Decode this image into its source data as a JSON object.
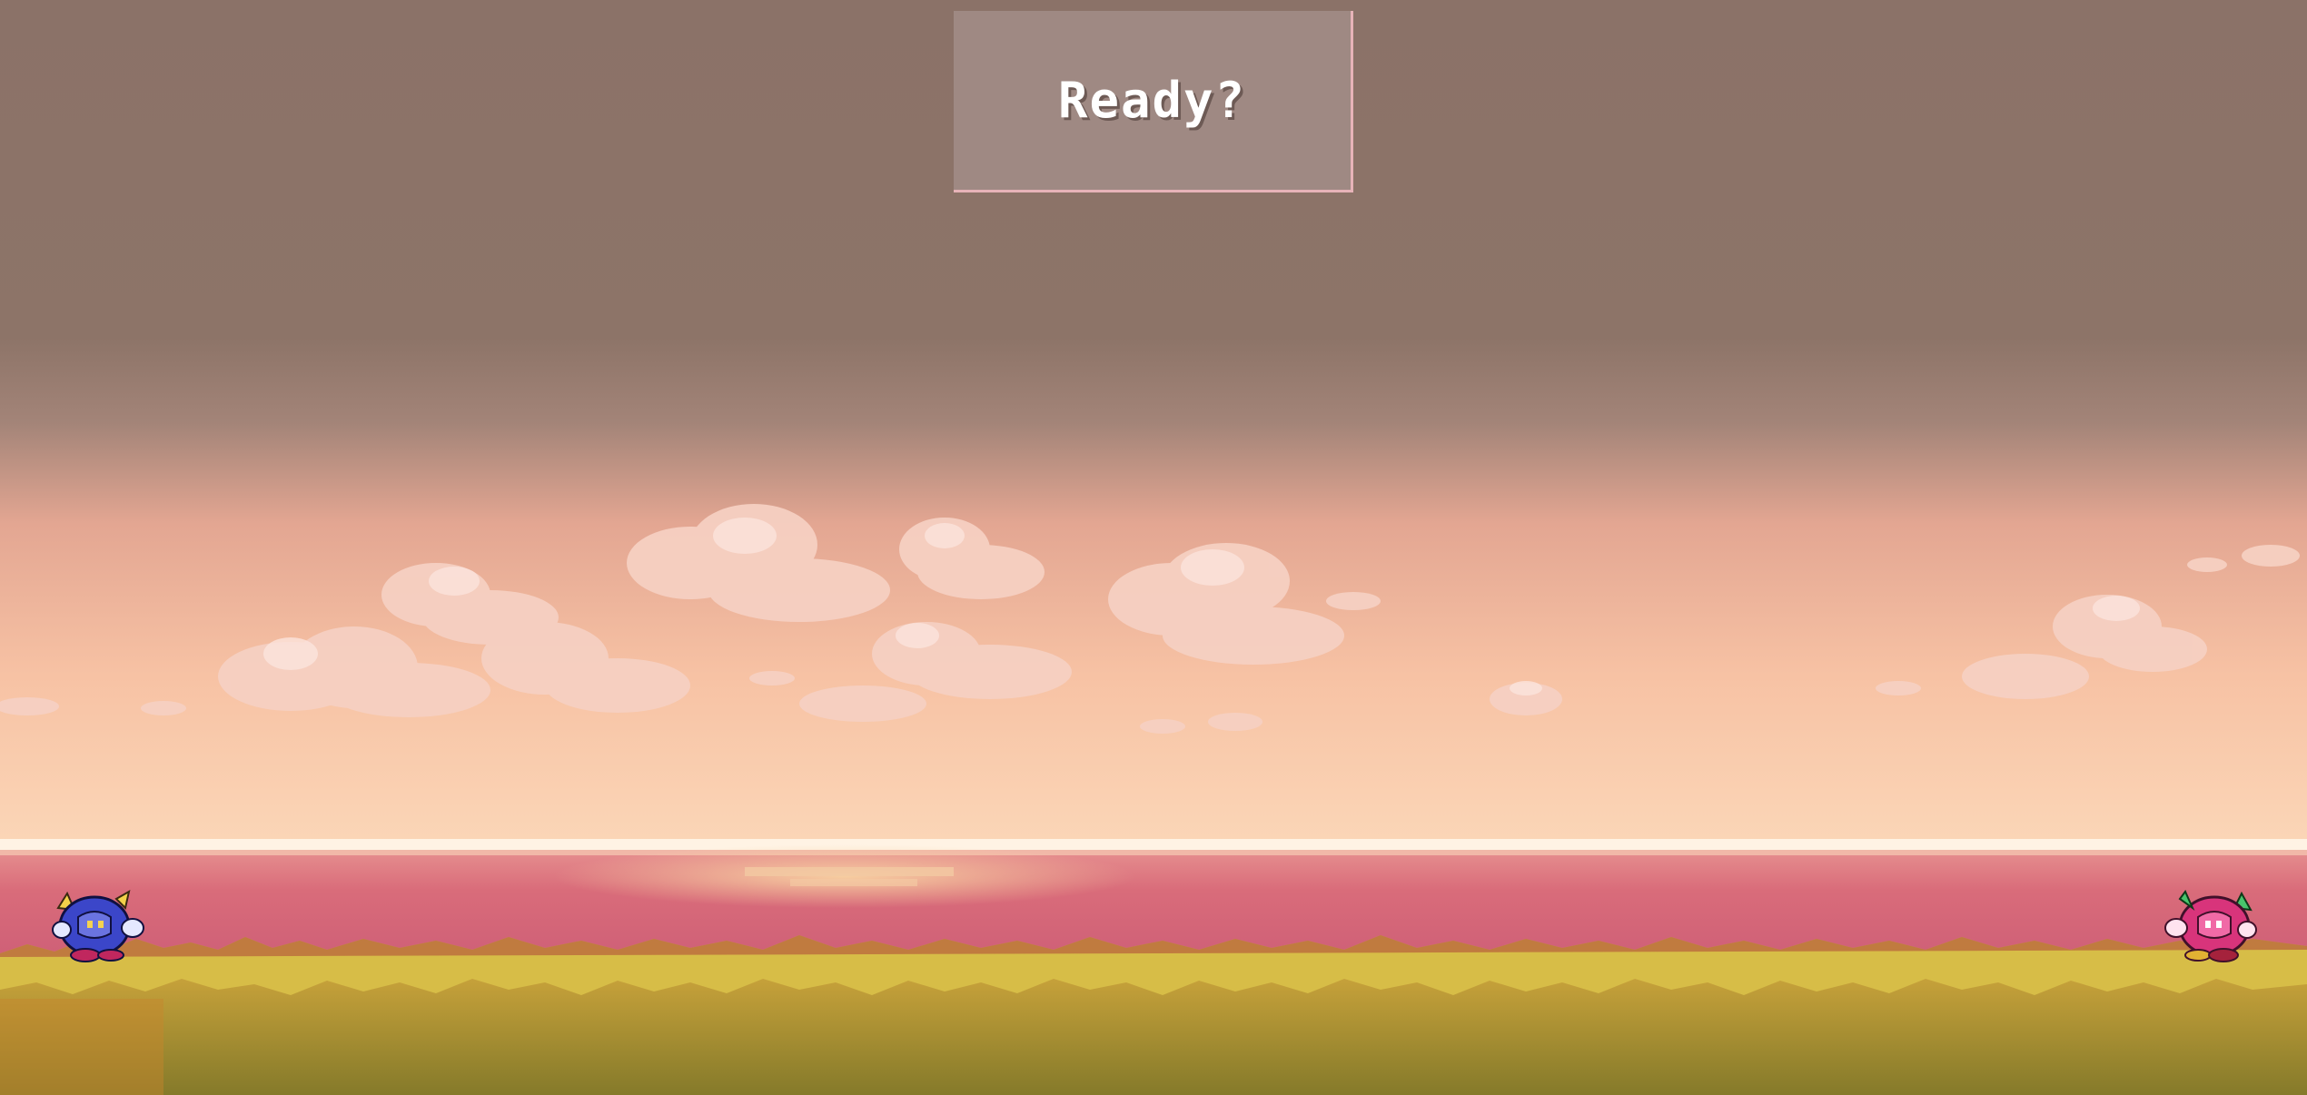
{
  "hud": {
    "status_text": "Ready?"
  },
  "players": {
    "left": {
      "icon": "blue-knight-icon",
      "color": "#3b46c9"
    },
    "right": {
      "icon": "pink-knight-icon",
      "color": "#d8347b"
    }
  },
  "colors": {
    "sky_top": "#8b7268",
    "sky_horizon": "#f6c0a0",
    "sea": "#d66577",
    "grass": "#d7bd47",
    "ground": "#8a7a2a"
  }
}
